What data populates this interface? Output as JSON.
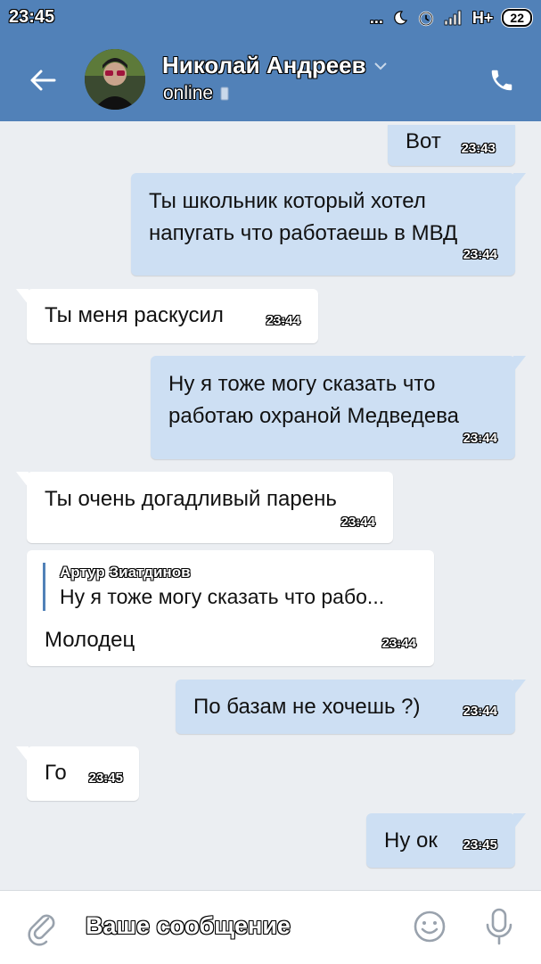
{
  "status_bar": {
    "time": "23:45",
    "dots": "...",
    "network": "H+",
    "battery": "22"
  },
  "header": {
    "contact_name": "Николай Андреев",
    "contact_status": "online"
  },
  "messages": [
    {
      "dir": "out",
      "text": "Вот",
      "time": "23:43"
    },
    {
      "dir": "out",
      "text": "Ты школьник который хотел напугать что работаешь в МВД",
      "time": "23:44"
    },
    {
      "dir": "in",
      "text": "Ты меня раскусил",
      "time": "23:44"
    },
    {
      "dir": "out",
      "text": "Ну я тоже могу сказать что работаю охраной Медведева",
      "time": "23:44"
    },
    {
      "dir": "in",
      "text": "Ты очень догадливый парень",
      "time": "23:44"
    },
    {
      "dir": "in",
      "reply_author": "Артур Зиатдинов",
      "reply_text": "Ну я тоже могу сказать что рабо...",
      "text": "Молодец",
      "time": "23:44"
    },
    {
      "dir": "out",
      "text": "По базам не хочешь ?)",
      "time": "23:44"
    },
    {
      "dir": "in",
      "text": "Го",
      "time": "23:45"
    },
    {
      "dir": "out",
      "text": "Ну ок",
      "time": "23:45"
    }
  ],
  "input": {
    "placeholder": "Ваше сообщение"
  },
  "colors": {
    "header_bg": "#5181b8",
    "chat_bg": "#ebeef2",
    "outgoing_bubble": "#cddff3",
    "incoming_bubble": "#ffffff"
  },
  "icons": {
    "back": "arrow-left-icon",
    "phone": "phone-icon",
    "attach": "paperclip-icon",
    "emoji": "smiley-icon",
    "mic": "microphone-icon"
  }
}
